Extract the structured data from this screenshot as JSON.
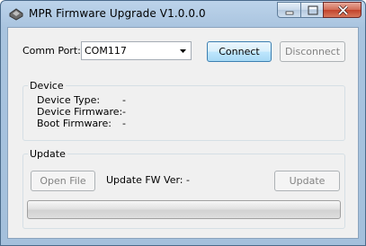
{
  "window": {
    "title": "MPR Firmware Upgrade  V1.0.0.0",
    "icon": "app-icon",
    "controls": [
      "minimize-icon",
      "maximize-icon",
      "close-icon"
    ]
  },
  "connection": {
    "comm_port_label": "Comm Port:",
    "comm_port_value": "COM117",
    "connect_label": "Connect",
    "disconnect_label": "Disconnect"
  },
  "device": {
    "group_title": "Device",
    "type_label": "Device Type:",
    "type_value": "-",
    "firmware_label": "Device Firmware:",
    "firmware_value": "-",
    "boot_label": "Boot Firmware:",
    "boot_value": "-"
  },
  "update": {
    "group_title": "Update",
    "open_file_label": "Open File",
    "fw_ver_label": "Update FW Ver:",
    "fw_ver_value": "-",
    "update_label": "Update",
    "progress": 0
  }
}
